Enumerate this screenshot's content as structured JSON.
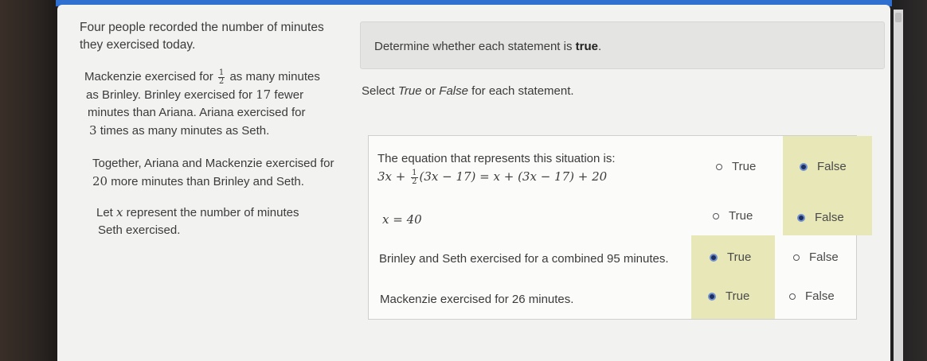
{
  "problem": {
    "intro": "Four people recorded the number of minutes they exercised today.",
    "p1_before_frac": "Mackenzie exercised for",
    "p1_frac_num": "1",
    "p1_frac_den": "2",
    "p1_after_frac": "as many minutes",
    "p1_line2_a": "as Brinley. Brinley exercised for",
    "p1_line2_num": "17",
    "p1_line2_b": "fewer",
    "p1_line3": "minutes than Ariana. Ariana exercised for",
    "p1_line4_num": "3",
    "p1_line4": "times as many minutes as Seth.",
    "p2_line1": "Together, Ariana and Mackenzie exercised for",
    "p2_line2_num": "20",
    "p2_line2": "more minutes than Brinley and Seth.",
    "p3_a": "Let",
    "p3_var": "x",
    "p3_b": "represent the number of minutes",
    "p3_line2": "Seth exercised."
  },
  "instruction": {
    "text": "Determine whether each statement is",
    "emphasis": "true",
    "period": "."
  },
  "select_line": {
    "a": "Select",
    "true_word": "True",
    "or": "or",
    "false_word": "False",
    "b": "for each statement."
  },
  "statements": [
    {
      "text_line1": "The equation that represents this situation is:",
      "eq_left_a": "3x +",
      "eq_frac_num": "1",
      "eq_frac_den": "2",
      "eq_right": "(3x − 17) = x + (3x − 17) + 20",
      "selected": "False"
    },
    {
      "math": "x = 40",
      "selected": "False"
    },
    {
      "text": "Brinley and Seth exercised for a combined 95 minutes.",
      "selected": "True"
    },
    {
      "text": "Mackenzie exercised for 26 minutes.",
      "selected": "True"
    }
  ],
  "options": {
    "true_label": "True",
    "false_label": "False"
  },
  "colors": {
    "selected_bg": "#e7e7b8",
    "radio_selected": "#1c2f5e",
    "screen_bg": "#f2f2f1"
  }
}
